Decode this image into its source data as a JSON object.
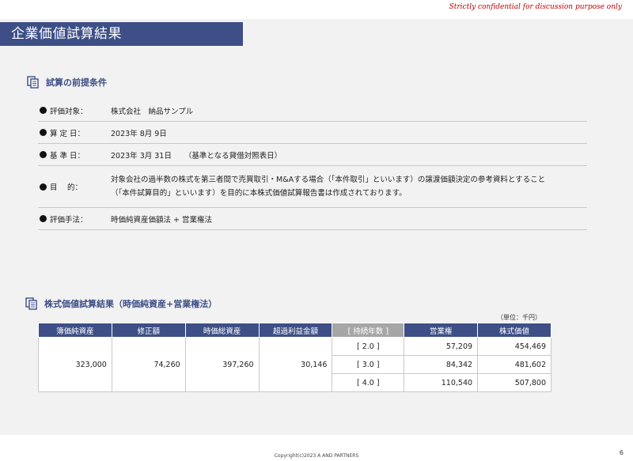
{
  "confidential": "Strictly confidential for discussion purpose only",
  "title": "企業価値試算結果",
  "section1": {
    "heading": "試算の前提条件",
    "rows": [
      {
        "key": "評価対象：",
        "value": "株式会社　納品サンプル"
      },
      {
        "key": "算 定 日：",
        "value": "2023年 8月 9日"
      },
      {
        "key": "基 準 日：",
        "value": "2023年 3月 31日",
        "aside": "（基準となる貸借対照表日）"
      },
      {
        "key": "目　 的：",
        "line1": "対象会社の過半数の株式を第三者間で売買取引・M&Aする場合（「本件取引」といいます）の譲渡価額決定の参考資料とすること",
        "line2": "（「本件試算目的」といいます）を目的に本株式価値試算報告書は作成されております。"
      },
      {
        "key": "評価手法：",
        "value": "時価純資産価額法 + 営業権法"
      }
    ]
  },
  "section2": {
    "heading": "株式価値試算結果（時価純資産+営業権法）",
    "unit": "（単位：千円）",
    "headers": [
      "簿価純資産",
      "修正額",
      "時価総資産",
      "超過利益金額",
      "[ 持続年数 ]",
      "営業権",
      "株式価値"
    ],
    "common": {
      "book_net_assets": "323,000",
      "adjustment": "74,260",
      "market_total_assets": "397,260",
      "excess_profit": "30,146"
    },
    "rows": [
      {
        "years": "[ 2.0 ]",
        "goodwill": "57,209",
        "equity_value": "454,469"
      },
      {
        "years": "[ 3.0 ]",
        "goodwill": "84,342",
        "equity_value": "481,602"
      },
      {
        "years": "[ 4.0 ]",
        "goodwill": "110,540",
        "equity_value": "507,800"
      }
    ]
  },
  "footer": "Copyright(c)2023  A AND PARTNERS",
  "page_number": "6"
}
